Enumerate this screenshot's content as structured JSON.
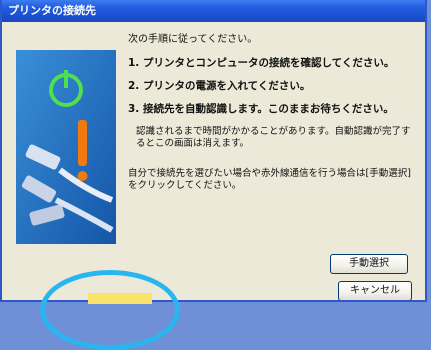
{
  "window": {
    "title": "プリンタの接続先"
  },
  "content": {
    "instruction": "次の手順に従ってください。",
    "steps": [
      "1. プリンタとコンピュータの接続を確認してください。",
      "2. プリンタの電源を入れてください。",
      "3. 接続先を自動認識します。このままお待ちください。"
    ],
    "note": "認識されるまで時間がかかることがあります。自動認識が完了するとこの画面は消えます。",
    "hint": "自分で接続先を選びたい場合や赤外線通信を行う場合は[手動選択]をクリックしてください。"
  },
  "buttons": {
    "manual_label": "手動選択",
    "cancel_label": "キャンセル"
  },
  "icons": {
    "power": "power-icon",
    "warning": "exclamation-icon",
    "cables": "usb-cable-icon"
  },
  "colors": {
    "titlebar": "#1d4fd0",
    "highlight": "#29b6f0",
    "power_green": "#3cc23c",
    "warning": "#f07a10"
  }
}
